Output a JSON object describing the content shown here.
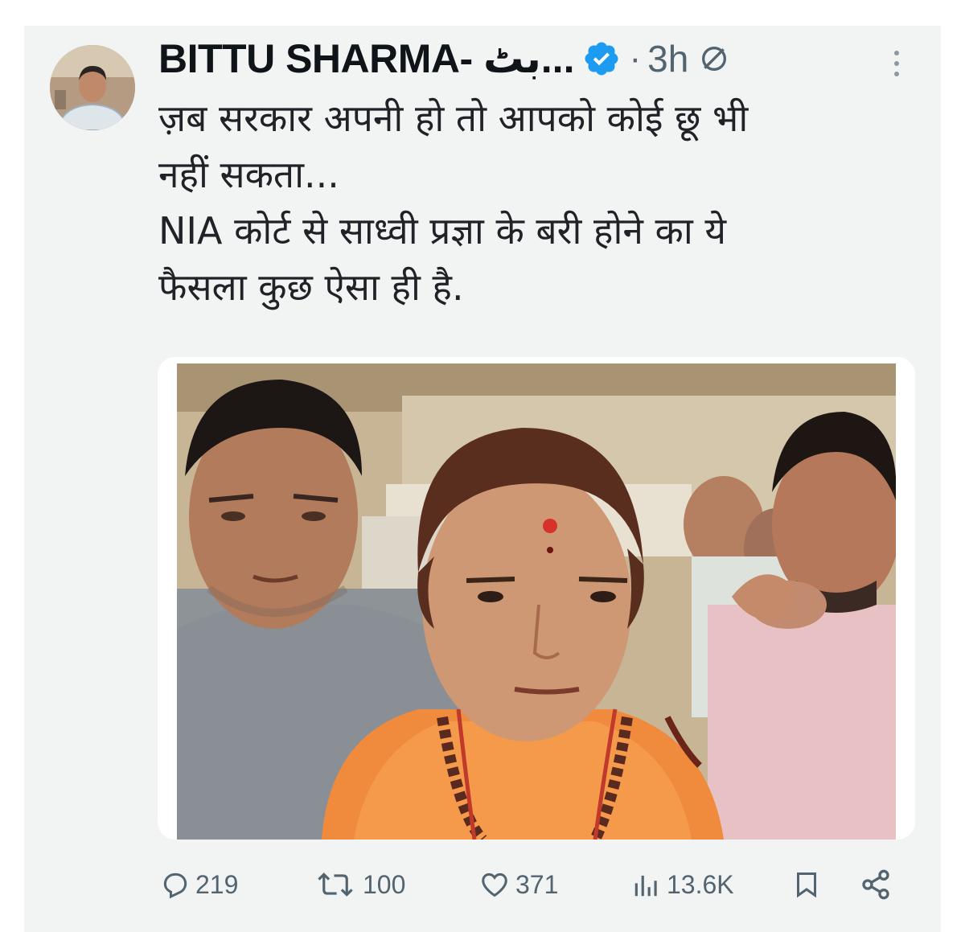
{
  "tweet": {
    "author_name": "BITTU SHARMA- بٹ...",
    "verified": true,
    "time": "3h",
    "text_line_1": "ज़ब सरकार अपनी हो तो आपको कोई छू भी",
    "text_line_2": "नहीं सकता...",
    "text_line_3": "NIA कोर्ट से साध्वी प्रज्ञा के बरी होने का ये",
    "text_line_4": "फैसला कुछ ऐसा ही है."
  },
  "actions": {
    "replies": "219",
    "reposts": "100",
    "likes": "371",
    "views": "13.6K"
  },
  "icons": {
    "reply": "reply-icon",
    "repost": "repost-icon",
    "like": "heart-icon",
    "views": "views-icon",
    "bookmark": "bookmark-icon",
    "share": "share-icon",
    "verified": "verified-badge-icon",
    "more": "more-icon"
  },
  "colors": {
    "verified_blue": "#1d9bf0",
    "muted_text": "#536471"
  }
}
